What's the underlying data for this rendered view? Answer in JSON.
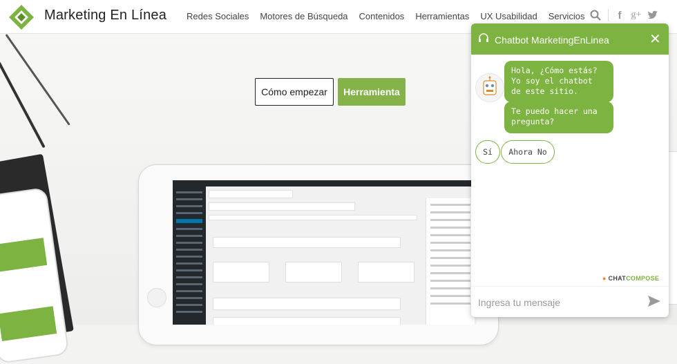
{
  "header": {
    "brand": "Marketing En Línea",
    "nav": [
      "Redes Sociales",
      "Motores de Búsqueda",
      "Contenidos",
      "Herramientas",
      "UX Usabilidad",
      "Servicios"
    ],
    "icons": [
      "search-icon",
      "facebook-icon",
      "google-plus-icon",
      "twitter-icon"
    ]
  },
  "hero": {
    "start_button": "Cómo empezar",
    "tool_button": "Herramienta"
  },
  "chat": {
    "title": "Chatbot MarketingEnLinea",
    "messages": [
      "Hola, ¿Cómo estás? Yo soy el chatbot de este sitio.",
      "Te puedo hacer una pregunta?"
    ],
    "options": [
      "Sí",
      "Ahora No"
    ],
    "powered_brand_a": "CHAT",
    "powered_brand_b": "COMPOSE",
    "input_placeholder": "Ingresa tu mensaje"
  },
  "colors": {
    "brand_green": "#7db340",
    "button_green": "#85b34a"
  }
}
